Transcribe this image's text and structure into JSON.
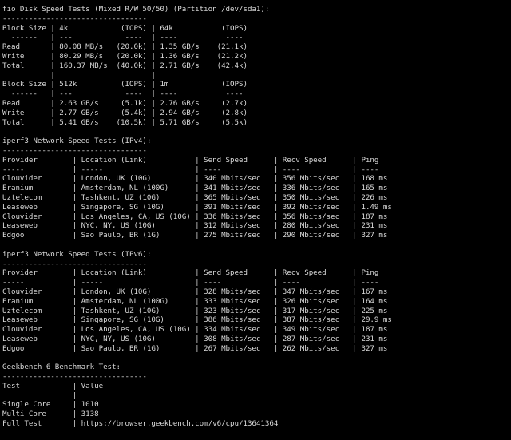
{
  "terminal": {
    "lines": [
      "fio Disk Speed Tests (Mixed R/W 50/50) (Partition /dev/sda1):",
      "---------------------------------",
      "Block Size | 4k            (IOPS) | 64k           (IOPS)",
      "  ------   | ---            ----  | ----           ----",
      "Read       | 80.08 MB/s   (20.0k) | 1.35 GB/s    (21.1k)",
      "Write      | 80.29 MB/s   (20.0k) | 1.36 GB/s    (21.2k)",
      "Total      | 160.37 MB/s  (40.0k) | 2.71 GB/s    (42.4k)",
      "           |                      |",
      "Block Size | 512k          (IOPS) | 1m            (IOPS)",
      "  ------   | ---            ----  | ----           ----",
      "Read       | 2.63 GB/s     (5.1k) | 2.76 GB/s     (2.7k)",
      "Write      | 2.77 GB/s     (5.4k) | 2.94 GB/s     (2.8k)",
      "Total      | 5.41 GB/s    (10.5k) | 5.71 GB/s     (5.5k)",
      "",
      "iperf3 Network Speed Tests (IPv4):",
      "---------------------------------",
      "Provider        | Location (Link)           | Send Speed      | Recv Speed      | Ping",
      "-----           | -----                     | ----            | ----            | ----",
      "Clouvider       | London, UK (10G)          | 340 Mbits/sec   | 356 Mbits/sec   | 168 ms",
      "Eranium         | Amsterdam, NL (100G)      | 341 Mbits/sec   | 336 Mbits/sec   | 165 ms",
      "Uztelecom       | Tashkent, UZ (10G)        | 365 Mbits/sec   | 350 Mbits/sec   | 226 ms",
      "Leaseweb        | Singapore, SG (10G)       | 391 Mbits/sec   | 392 Mbits/sec   | 1.49 ms",
      "Clouvider       | Los Angeles, CA, US (10G) | 336 Mbits/sec   | 356 Mbits/sec   | 187 ms",
      "Leaseweb        | NYC, NY, US (10G)         | 312 Mbits/sec   | 280 Mbits/sec   | 231 ms",
      "Edgoo           | Sao Paulo, BR (1G)        | 275 Mbits/sec   | 290 Mbits/sec   | 327 ms",
      "",
      "iperf3 Network Speed Tests (IPv6):",
      "---------------------------------",
      "Provider        | Location (Link)           | Send Speed      | Recv Speed      | Ping",
      "-----           | -----                     | ----            | ----            | ----",
      "Clouvider       | London, UK (10G)          | 328 Mbits/sec   | 347 Mbits/sec   | 167 ms",
      "Eranium         | Amsterdam, NL (100G)      | 333 Mbits/sec   | 326 Mbits/sec   | 164 ms",
      "Uztelecom       | Tashkent, UZ (10G)        | 323 Mbits/sec   | 317 Mbits/sec   | 225 ms",
      "Leaseweb        | Singapore, SG (10G)       | 386 Mbits/sec   | 387 Mbits/sec   | 29.9 ms",
      "Clouvider       | Los Angeles, CA, US (10G) | 334 Mbits/sec   | 349 Mbits/sec   | 187 ms",
      "Leaseweb        | NYC, NY, US (10G)         | 308 Mbits/sec   | 287 Mbits/sec   | 231 ms",
      "Edgoo           | Sao Paulo, BR (1G)        | 267 Mbits/sec   | 262 Mbits/sec   | 327 ms",
      "",
      "Geekbench 6 Benchmark Test:",
      "---------------------------------",
      "Test            | Value",
      "                |",
      "Single Core     | 1010",
      "Multi Core      | 3138",
      "Full Test       | https://browser.geekbench.com/v6/cpu/13641364"
    ]
  }
}
